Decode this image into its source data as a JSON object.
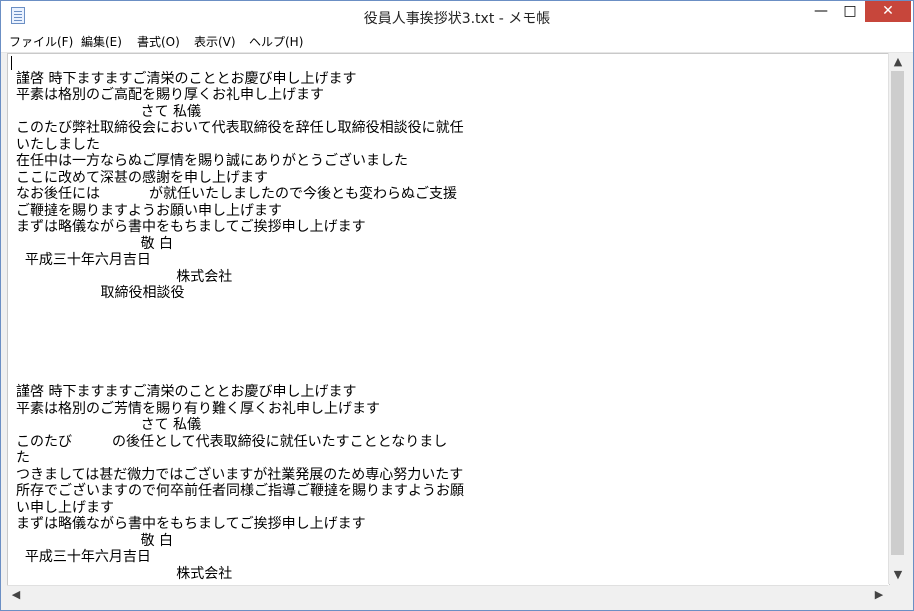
{
  "window": {
    "title": "役員人事挨拶状3.txt - メモ帳",
    "minimize": "—",
    "maximize": "□",
    "close": "✕"
  },
  "menu": [
    "ファイル(F)",
    "編集(E)",
    "書式(O)",
    "表示(V)",
    "ヘルプ(H)"
  ],
  "document": {
    "lines": [
      "",
      "謹啓 時下ますますご清栄のこととお慶び申し上げます",
      "平素は格別のご高配を賜り厚くお礼申し上げます",
      "                            さて 私儀",
      "このたび弊社取締役会において代表取締役を辞任し取締役相談役に就任",
      "いたしました",
      "在任中は一方ならぬご厚情を賜り誠にありがとうございました",
      "ここに改めて深甚の感謝を申し上げます",
      "なお後任には           が就任いたしましたので今後とも変わらぬご支援",
      "ご鞭撻を賜りますようお願い申し上げます",
      "まずは略儀ながら書中をもちましてご挨拶申し上げます",
      "                            敬 白",
      "  平成三十年六月吉日",
      "                                    株式会社",
      "                   取締役相談役",
      "",
      "",
      "",
      "",
      "",
      "謹啓 時下ますますご清栄のこととお慶び申し上げます",
      "平素は格別のご芳情を賜り有り難く厚くお礼申し上げます",
      "                            さて 私儀",
      "このたび         の後任として代表取締役に就任いたすこととなりまし",
      "た",
      "つきましては甚だ微力ではございますが社業発展のため専心努力いたす",
      "所存でございますので何卒前任者同様ご指導ご鞭撻を賜りますようお願",
      "い申し上げます",
      "まずは略儀ながら書中をもちましてご挨拶申し上げます",
      "                            敬 白",
      "  平成三十年六月吉日",
      "                                    株式会社"
    ]
  },
  "scrollbar": {
    "up": "▲",
    "down": "▼",
    "left": "◀",
    "right": "▶"
  }
}
